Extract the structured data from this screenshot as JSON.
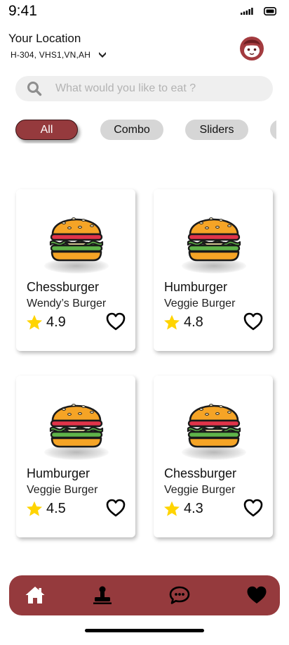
{
  "status_bar": {
    "time": "9:41",
    "signal_icon": "signal-icon",
    "battery_icon": "battery-icon"
  },
  "header": {
    "location_label": "Your Location",
    "location_value": "H-304, VHS1,VN,AH",
    "dropdown_icon": "chevron-down-icon",
    "avatar_icon": "avatar"
  },
  "search": {
    "placeholder": "What would you like to eat ?",
    "value": "",
    "icon": "search-icon"
  },
  "categories": [
    {
      "label": "All",
      "selected": true
    },
    {
      "label": "Combo",
      "selected": false
    },
    {
      "label": "Sliders",
      "selected": false
    }
  ],
  "products": [
    {
      "name": "Chessburger",
      "subtitle": "Wendy’s Burger",
      "rating": "4.9",
      "icon": "burger-icon"
    },
    {
      "name": "Humburger",
      "subtitle": "Veggie Burger",
      "rating": "4.8",
      "icon": "burger-icon"
    },
    {
      "name": "Humburger",
      "subtitle": "Veggie Burger",
      "rating": "4.5",
      "icon": "burger-icon"
    },
    {
      "name": "Chessburger",
      "subtitle": "Veggie Burger",
      "rating": "4.3",
      "icon": "burger-icon"
    }
  ],
  "bottom_nav": [
    {
      "icon": "home-icon",
      "active": true
    },
    {
      "icon": "stamp-icon",
      "active": false
    },
    {
      "icon": "chat-icon",
      "active": false
    },
    {
      "icon": "heart-icon",
      "active": false
    }
  ],
  "colors": {
    "accent": "#953a3d",
    "chip_bg": "#d6d6d6",
    "search_bg": "#efefef",
    "star": "#ffd400"
  }
}
